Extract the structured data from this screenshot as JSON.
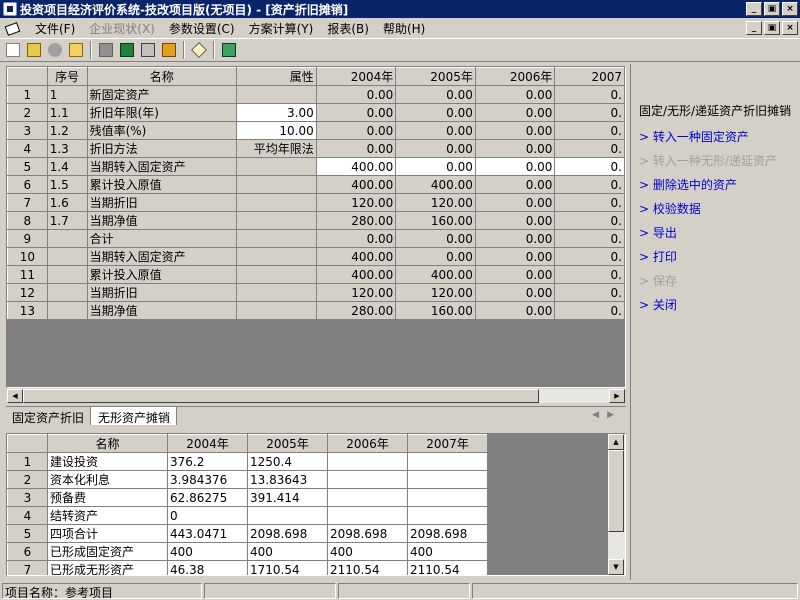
{
  "window": {
    "title": "投资项目经济评价系统-技改项目版(无项目) - [资产折旧摊销]",
    "minimize_glyph": "_",
    "maximize_glyph": "▣",
    "close_glyph": "×"
  },
  "menu": [
    {
      "label": "文件(F)",
      "enabled": true
    },
    {
      "label": "企业现状(X)",
      "enabled": false
    },
    {
      "label": "参数设置(C)",
      "enabled": true
    },
    {
      "label": "方案计算(Y)",
      "enabled": true
    },
    {
      "label": "报表(B)",
      "enabled": true
    },
    {
      "label": "帮助(H)",
      "enabled": true
    }
  ],
  "toolbar_icons": [
    "new-file-icon",
    "open-folder-icon",
    "disabled-stop-icon",
    "open-project-icon",
    "gray-box-icon",
    "excel-icon",
    "print-icon",
    "book-icon",
    "tag-icon",
    "exit-icon"
  ],
  "grid1": {
    "headers": [
      "",
      "序号",
      "名称",
      "属性",
      "2004年",
      "2005年",
      "2006年",
      "2007"
    ],
    "rows": [
      [
        "1",
        "1",
        "新固定资产",
        "",
        "0.00",
        "0.00",
        "0.00",
        "0."
      ],
      [
        "2",
        "1.1",
        "折旧年限(年)",
        "3.00",
        "0.00",
        "0.00",
        "0.00",
        "0."
      ],
      [
        "3",
        "1.2",
        "残值率(%)",
        "10.00",
        "0.00",
        "0.00",
        "0.00",
        "0."
      ],
      [
        "4",
        "1.3",
        "折旧方法",
        "平均年限法",
        "0.00",
        "0.00",
        "0.00",
        "0."
      ],
      [
        "5",
        "1.4",
        "当期转入固定资产",
        "",
        "400.00",
        "0.00",
        "0.00",
        "0."
      ],
      [
        "6",
        "1.5",
        "累计投入原值",
        "",
        "400.00",
        "400.00",
        "0.00",
        "0."
      ],
      [
        "7",
        "1.6",
        "当期折旧",
        "",
        "120.00",
        "120.00",
        "0.00",
        "0."
      ],
      [
        "8",
        "1.7",
        "当期净值",
        "",
        "280.00",
        "160.00",
        "0.00",
        "0."
      ],
      [
        "9",
        "",
        "合计",
        "",
        "0.00",
        "0.00",
        "0.00",
        "0."
      ],
      [
        "10",
        "",
        "当期转入固定资产",
        "",
        "400.00",
        "0.00",
        "0.00",
        "0."
      ],
      [
        "11",
        "",
        "累计投入原值",
        "",
        "400.00",
        "400.00",
        "0.00",
        "0."
      ],
      [
        "12",
        "",
        "当期折旧",
        "",
        "120.00",
        "120.00",
        "0.00",
        "0."
      ],
      [
        "13",
        "",
        "当期净值",
        "",
        "280.00",
        "160.00",
        "0.00",
        "0."
      ]
    ]
  },
  "tabs": [
    "固定资产折旧",
    "无形资产摊销"
  ],
  "grid2": {
    "headers": [
      "",
      "名称",
      "2004年",
      "2005年",
      "2006年",
      "2007年"
    ],
    "rows": [
      [
        "1",
        "建设投资",
        "376.2",
        "1250.4",
        "",
        ""
      ],
      [
        "2",
        "资本化利息",
        "3.984376",
        "13.83643",
        "",
        ""
      ],
      [
        "3",
        "预备费",
        "62.86275",
        "391.414",
        "",
        ""
      ],
      [
        "4",
        "结转资产",
        "0",
        "",
        "",
        ""
      ],
      [
        "5",
        "四项合计",
        "443.0471",
        "2098.698",
        "2098.698",
        "2098.698"
      ],
      [
        "6",
        "已形成固定资产",
        "400",
        "400",
        "400",
        "400"
      ],
      [
        "7",
        "已形成无形资产",
        "46.38",
        "1710.54",
        "2110.54",
        "2110.54"
      ]
    ]
  },
  "side_panel": {
    "title": "固定/无形/递延资产折旧摊销",
    "items": [
      {
        "label": "> 转入一种固定资产",
        "enabled": true
      },
      {
        "label": "> 转入一种无形/递延资产",
        "enabled": false
      },
      {
        "label": "> 删除选中的资产",
        "enabled": true
      },
      {
        "label": "> 校验数据",
        "enabled": true
      },
      {
        "label": "> 导出",
        "enabled": true
      },
      {
        "label": "> 打印",
        "enabled": true
      },
      {
        "label": "> 保存",
        "enabled": false
      },
      {
        "label": "> 关闭",
        "enabled": true
      }
    ]
  },
  "status": {
    "project": "项目名称：参考项目"
  }
}
